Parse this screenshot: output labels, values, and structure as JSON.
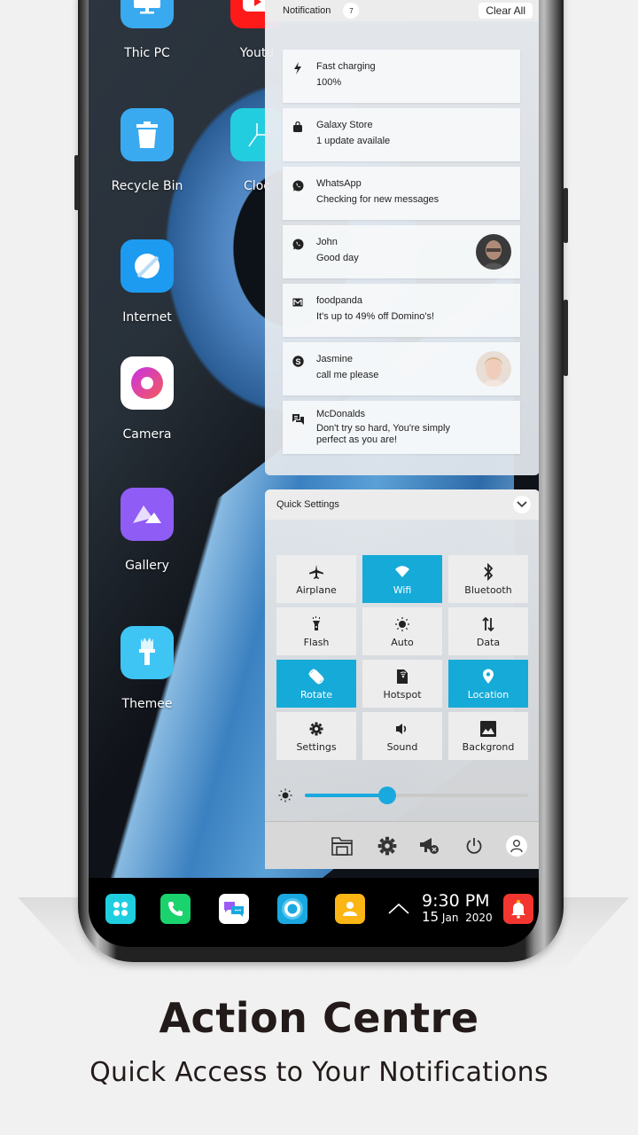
{
  "desktop_apps": [
    {
      "label": "Thic PC",
      "icon": "monitor-icon",
      "color": "#3aaaf0"
    },
    {
      "label": "Youtu",
      "icon": "youtube-icon",
      "color": "#ff1a1a"
    },
    {
      "label": "Recycle Bin",
      "icon": "trash-icon",
      "color": "#3aaaf0"
    },
    {
      "label": "Cloc",
      "icon": "clock-icon",
      "color": "#23cde0"
    },
    {
      "label": "Internet",
      "icon": "globe-icon",
      "color": "#1d9bf0"
    },
    {
      "label": "Camera",
      "icon": "camera-icon",
      "color": "#ffffff"
    },
    {
      "label": "Gallery",
      "icon": "mountain-icon",
      "color": "#8f5cf5"
    },
    {
      "label": "Themee",
      "icon": "paintbrush-icon",
      "color": "#3ec5f4"
    }
  ],
  "notification_panel": {
    "title": "Notification",
    "count": "7",
    "clear_all_label": "Clear All",
    "items": [
      {
        "icon": "lightning-icon",
        "title": "Fast charging",
        "body": "100%",
        "avatar": null
      },
      {
        "icon": "shopping-bag-icon",
        "title": "Galaxy Store",
        "body": "1 update availale",
        "avatar": null
      },
      {
        "icon": "whatsapp-icon",
        "title": "WhatsApp",
        "body": "Checking for new messages",
        "avatar": null
      },
      {
        "icon": "whatsapp-icon",
        "title": "John",
        "body": "Good day",
        "avatar": "man"
      },
      {
        "icon": "mail-icon",
        "title": "foodpanda",
        "body": "It's up to 49% off Domino's!",
        "avatar": null
      },
      {
        "icon": "skype-icon",
        "title": "Jasmine",
        "body": "call me please",
        "avatar": "woman"
      },
      {
        "icon": "chat-icon",
        "title": "McDonalds",
        "body": "Don't try so hard, You're simply perfect as you are!",
        "avatar": null
      }
    ]
  },
  "quick_settings": {
    "title": "Quick Settings",
    "tiles": [
      {
        "label": "Airplane",
        "icon": "airplane-icon",
        "on": false
      },
      {
        "label": "Wifi",
        "icon": "wifi-icon",
        "on": true
      },
      {
        "label": "Bluetooth",
        "icon": "bluetooth-icon",
        "on": false
      },
      {
        "label": "Flash",
        "icon": "flashlight-icon",
        "on": false
      },
      {
        "label": "Auto",
        "icon": "brightness-auto-icon",
        "on": false
      },
      {
        "label": "Data",
        "icon": "data-arrows-icon",
        "on": false
      },
      {
        "label": "Rotate",
        "icon": "rotate-icon",
        "on": true
      },
      {
        "label": "Hotspot",
        "icon": "hotspot-icon",
        "on": false
      },
      {
        "label": "Location",
        "icon": "location-pin-icon",
        "on": true
      },
      {
        "label": "Settings",
        "icon": "gear-icon",
        "on": false
      },
      {
        "label": "Sound",
        "icon": "speaker-icon",
        "on": false
      },
      {
        "label": "Backgrond",
        "icon": "image-icon",
        "on": false
      }
    ],
    "brightness_percent": 37,
    "footer_buttons": [
      "file-explorer-icon",
      "settings-gear-icon",
      "do-not-disturb-icon",
      "power-icon",
      "user-icon"
    ]
  },
  "taskbar": {
    "dock": [
      {
        "icon": "apps-grid-icon",
        "color": "#1fcfe0"
      },
      {
        "icon": "phone-icon",
        "color": "#1bd36d"
      },
      {
        "icon": "messages-icon",
        "color": "#ffffff"
      },
      {
        "icon": "browser-ring-icon",
        "color": "#1aa8e0"
      },
      {
        "icon": "contacts-icon",
        "color": "#fbb515"
      }
    ],
    "time": "9:30 PM",
    "date_day": "15",
    "date_month": "Jan",
    "date_year": "2020",
    "accent": "#16aad8"
  },
  "promo": {
    "headline": "Action Centre",
    "subline": "Quick Access to Your Notifications"
  }
}
